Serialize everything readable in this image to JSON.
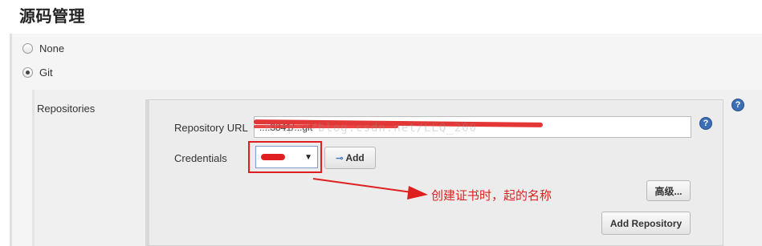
{
  "section": {
    "title": "源码管理"
  },
  "scm_options": [
    {
      "label": "None",
      "selected": false
    },
    {
      "label": "Git",
      "selected": true
    }
  ],
  "repositories": {
    "label": "Repositories",
    "url_label": "Repository URL",
    "url_value": "...:3841/...git",
    "credentials_label": "Credentials",
    "credentials_value": "",
    "add_button": "Add",
    "advanced_button": "高级...",
    "add_repository_button": "Add Repository",
    "help_glyph": "?"
  },
  "annotation": {
    "text": "创建证书时，起的名称"
  },
  "watermark": {
    "text": "http://blog.csdn.net/LLQ_200"
  },
  "colors": {
    "annotation": "#e02020",
    "help_icon": "#3d6fb6"
  },
  "icons": {
    "help": "help-icon",
    "key": "key-icon",
    "dropdown": "dropdown-arrow-icon"
  }
}
